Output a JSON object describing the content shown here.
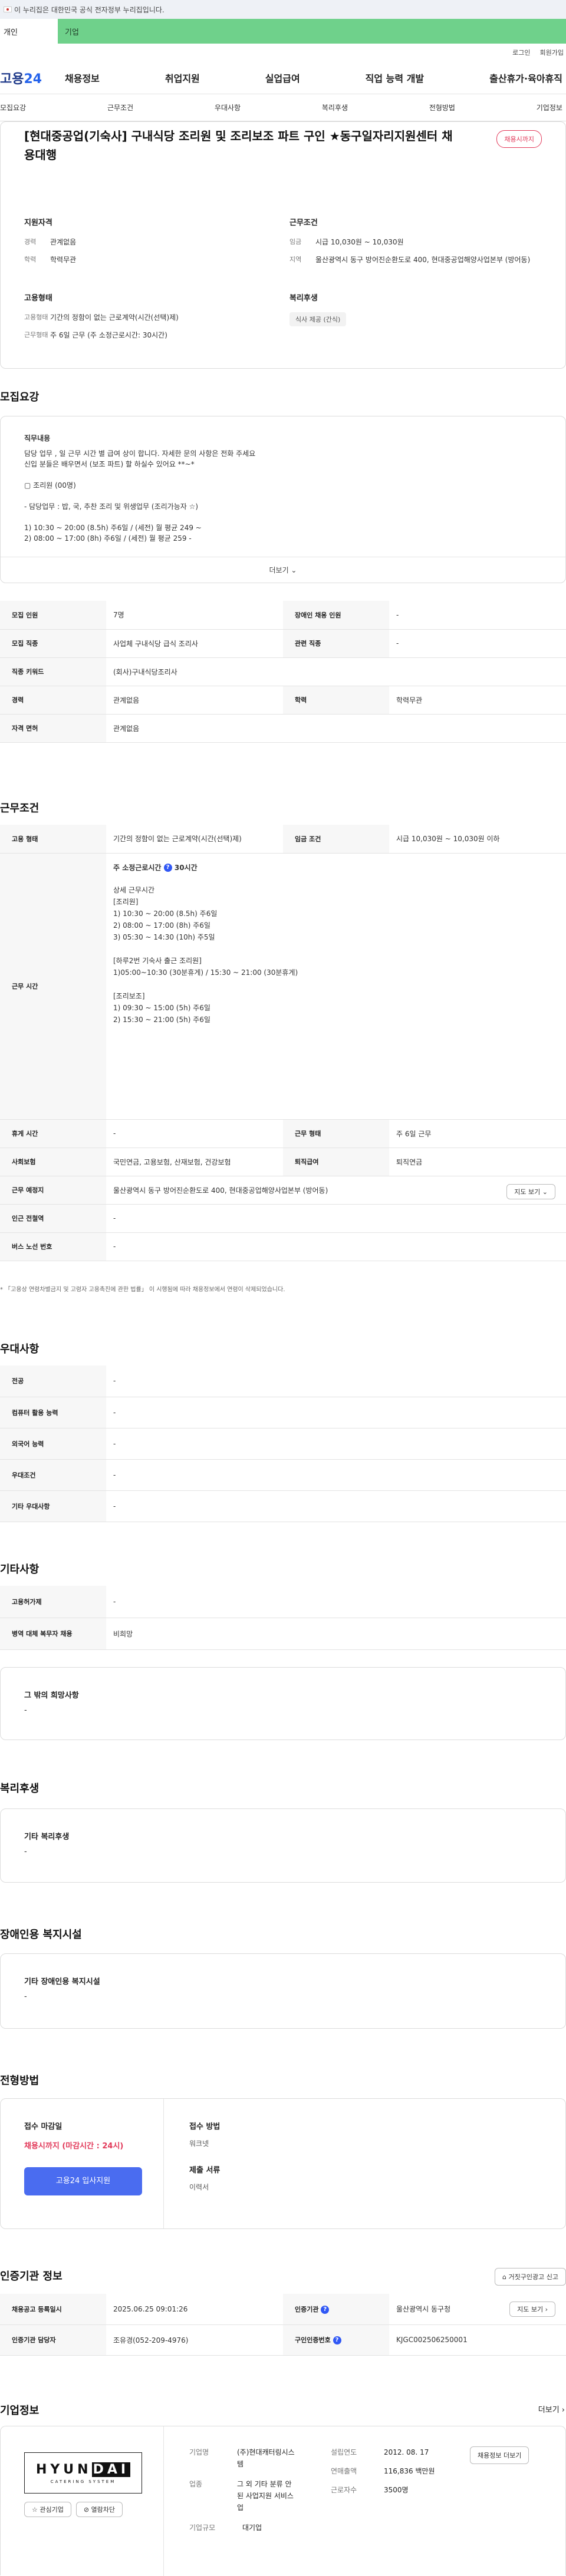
{
  "gov_bar": {
    "text": "이 누리집은 대한민국 공식 전자정부 누리집입니다."
  },
  "user_tabs": {
    "personal": "개인",
    "corporate": "기업"
  },
  "util": {
    "login": "로그인",
    "join": "회원가입"
  },
  "gnb": {
    "logo_prefix": "고용",
    "logo_suffix": "24",
    "menu": [
      "채용정보",
      "취업지원",
      "실업급여",
      "직업 능력 개발",
      "출산휴가·육아휴직"
    ]
  },
  "anchor_tabs": [
    "모집요강",
    "근무조건",
    "우대사항",
    "복리후생",
    "전형방법",
    "기업정보"
  ],
  "header": {
    "title": "[현대중공업(기숙사] 구내식당 조리원 및 조리보조 파트 구인 ★동구일자리지원센터 채용대행",
    "badge": "채용시까지",
    "qualification": {
      "heading": "지원자격",
      "career_label": "경력",
      "career_value": "관계없음",
      "edu_label": "학력",
      "edu_value": "학력무관"
    },
    "work_cond": {
      "heading": "근무조건",
      "wage_label": "임금",
      "wage_value": "시급 10,030원 ~ 10,030원",
      "region_label": "지역",
      "region_value": "울산광역시 동구 방어진순환도로 400, 현대중공업해양사업본부 (방어동)"
    },
    "employ": {
      "heading": "고용형태",
      "type_label": "고용형태",
      "type_value": "기간의 정함이 없는 근로계약(시간(선택)제)",
      "form_label": "근무형태",
      "form_value": "주 6일 근무 (주 소정근로시간: 30시간)"
    },
    "welfare": {
      "heading": "복리후생",
      "tag": "식사 제공 (간식)"
    }
  },
  "recruit": {
    "section_title": "모집요강",
    "desc_heading": "직무내용",
    "desc_lines": [
      "담당 업무 , 일 근무 시간 별 급여 상이 합니다. 자세한 문의 사항은 전화 주세요",
      "신입 분들은 배우면서 (보조 파트) 할 하실수 있어요 **~*",
      "",
      "▢ 조리원 (00명)",
      "",
      "- 담당업무 : 밥, 국, 추찬 조리 및 위생업무 (조리가능자 ☆)",
      "",
      "1) 10:30 ~ 20:00 (8.5h) 주6일 / (세전) 월 평균 249 ~",
      "2) 08:00 ~ 17:00 (8h) 주6일 / (세전) 월 평균 259 -"
    ],
    "more_label": "더보기 ⌄",
    "rows": [
      [
        "모집 인원",
        "7명",
        "장애인 채용 인원",
        "-"
      ],
      [
        "모집 직종",
        "사업체 구내식당 급식 조리사",
        "관련 직종",
        "-"
      ],
      [
        "직종 키워드",
        "(회사)구내식당조리사",
        "",
        ""
      ],
      [
        "경력",
        "관계없음",
        "학력",
        "학력무관"
      ],
      [
        "자격 면허",
        "관계없음",
        "",
        ""
      ]
    ]
  },
  "conditions": {
    "section_title": "근무조건",
    "employ_label": "고용 형태",
    "employ_value": "기간의 정함이 없는 근로계약(시간(선택)제)",
    "wage_label": "임금 조건",
    "wage_value": "시급 10,030원 ~ 10,030원 이하",
    "hours_label": "근무 시간",
    "hours_head": "주 소정근로시간",
    "hours_value": "30시간",
    "hours_lines": [
      "상세 근무시간",
      "[조리원]",
      "1) 10:30 ~ 20:00 (8.5h) 주6일",
      "2) 08:00 ~ 17:00 (8h) 주6일",
      "3) 05:30 ~ 14:30 (10h) 주5일",
      "",
      "[하루2번 기숙사 출근 조리원]",
      "1)05:00~10:30 (30분휴게) / 15:30 ~ 21:00 (30분휴게)",
      "",
      "[조리보조]",
      "1) 09:30 ~ 15:00 (5h) 주6일",
      "2) 15:30 ~ 21:00 (5h) 주6일"
    ],
    "rest_label": "휴게 시간",
    "rest_value": "-",
    "form_label": "근무 형태",
    "form_value": "주 6일 근무",
    "insurance_label": "사회보험",
    "insurance_value": "국민연금, 고용보험, 산재보험, 건강보험",
    "retire_label": "퇴직급여",
    "retire_value": "퇴직연금",
    "place_label": "근무 예정지",
    "place_value": "울산광역시 동구 방어진순환도로 400, 현대중공업해양사업본부 (방어동)",
    "map_button": "지도 보기 ⌄",
    "station_label": "인근 전철역",
    "station_value": "-",
    "bus_label": "버스 노선 번호",
    "bus_value": "-",
    "note": "* 「고용상 연령차별금지 및 고령자 고용촉진에 관한 법률」 이 시행됨에 따라 채용정보에서 연령이 삭제되었습니다."
  },
  "preference": {
    "section_title": "우대사항",
    "rows": [
      [
        "전공",
        "-"
      ],
      [
        "컴퓨터 활용 능력",
        "-"
      ],
      [
        "외국어 능력",
        "-"
      ],
      [
        "우대조건",
        "-"
      ],
      [
        "기타 우대사항",
        "-"
      ]
    ]
  },
  "etc": {
    "section_title": "기타사항",
    "rows": [
      [
        "고용허가제",
        "-"
      ],
      [
        "병역 대체 복무자 채용",
        "비희망"
      ]
    ],
    "extra_heading": "그 밖의 희망사항",
    "extra_value": "-"
  },
  "welfare": {
    "section_title": "복리후생",
    "heading": "기타 복리후생",
    "value": "-"
  },
  "disability": {
    "section_title": "장애인용 복지시설",
    "heading": "기타 장애인용 복지시설",
    "value": "-"
  },
  "selection": {
    "section_title": "전형방법",
    "deadline_label": "접수 마감일",
    "deadline_value": "채용시까지 (마감시간 : 24시)",
    "apply_button": "고용24 입사지원",
    "method_label": "접수 방법",
    "method_value": "워크넷",
    "docs_label": "제출 서류",
    "docs_value": "이력서"
  },
  "agency": {
    "section_title": "인증기관 정보",
    "report_button": "거짓구인광고 신고",
    "registered_label": "채용공고 등록일시",
    "registered_value": "2025.06.25 09:01:26",
    "agency_label": "인증기관",
    "agency_value": "울산광역시 동구청",
    "map_button": "지도 보기 ›",
    "contact_label": "인증기관 담당자",
    "contact_value": "조유경(052-209-4976)",
    "job_no_label": "구인인증번호",
    "job_no_value": "KJGC002506250001"
  },
  "company": {
    "section_title": "기업정보",
    "more": "더보기 ›",
    "logo_text_a": "HYUN",
    "logo_text_b": "DAI",
    "logo_sub": "CATERING SYSTEM",
    "fav_button": "☆ 관심기업",
    "filter_button": "⊘ 열람차단",
    "name_label": "기업명",
    "name_value": "(주)현대캐터링시스템",
    "industry_label": "업종",
    "industry_value": "그 외 기타 분류 안된 사업지원 서비스업",
    "size_label": "기업규모",
    "size_value": "대기업",
    "founded_label": "설립연도",
    "founded_value": "2012. 08. 17",
    "sales_label": "연매출액",
    "sales_value": "116,836 백만원",
    "staff_label": "근로자수",
    "staff_value": "3500명",
    "more_jobs_button": "채용정보 더보기"
  }
}
